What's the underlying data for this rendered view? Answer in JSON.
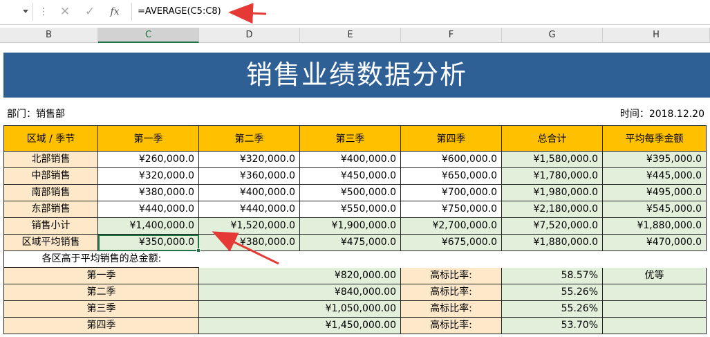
{
  "formula_bar": {
    "formula": "=AVERAGE(C5:C8)",
    "fx_label": "fx"
  },
  "columns": [
    "B",
    "C",
    "D",
    "E",
    "F",
    "G",
    "H"
  ],
  "title": "销售业绩数据分析",
  "department": "部门：销售部",
  "time": "时间：2018.12.20",
  "table": {
    "headers": [
      "区域 / 季节",
      "第一季",
      "第二季",
      "第三季",
      "第四季",
      "总合计",
      "平均每季金额"
    ],
    "rows": [
      [
        "北部销售",
        "¥260,000.0",
        "¥320,000.0",
        "¥400,000.0",
        "¥600,000.0",
        "¥1,580,000.0",
        "¥395,000.0"
      ],
      [
        "中部销售",
        "¥320,000.0",
        "¥360,000.0",
        "¥450,000.0",
        "¥650,000.0",
        "¥1,780,000.0",
        "¥445,000.0"
      ],
      [
        "南部销售",
        "¥380,000.0",
        "¥400,000.0",
        "¥500,000.0",
        "¥700,000.0",
        "¥1,980,000.0",
        "¥495,000.0"
      ],
      [
        "东部销售",
        "¥440,000.0",
        "¥440,000.0",
        "¥550,000.0",
        "¥750,000.0",
        "¥2,180,000.0",
        "¥545,000.0"
      ],
      [
        "销售小计",
        "¥1,400,000.0",
        "¥1,520,000.0",
        "¥1,900,000.0",
        "¥2,700,000.0",
        "¥7,520,000.0",
        "¥1,880,000.0"
      ],
      [
        "区域平均销售",
        "¥350,000.0",
        "¥380,000.0",
        "¥475,000.0",
        "¥675,000.0",
        "¥1,880,000.0",
        "¥470,000.0"
      ]
    ]
  },
  "summary": {
    "label": "各区高于平均销售的总金额:",
    "rows": [
      {
        "season": "第一季",
        "amount": "¥820,000.00",
        "ratio_label": "高标比率:",
        "ratio": "58.57%",
        "grade": "优等"
      },
      {
        "season": "第二季",
        "amount": "¥840,000.00",
        "ratio_label": "高标比率:",
        "ratio": "55.26%",
        "grade": ""
      },
      {
        "season": "第三季",
        "amount": "¥1,050,000.00",
        "ratio_label": "高标比率:",
        "ratio": "55.26%",
        "grade": ""
      },
      {
        "season": "第四季",
        "amount": "¥1,450,000.00",
        "ratio_label": "高标比率:",
        "ratio": "53.70%",
        "grade": ""
      }
    ]
  },
  "colors": {
    "title_band": "#2f6095",
    "header": "#ffc000",
    "beige": "#fde9c9",
    "green": "#e2efda",
    "selection": "#217346",
    "arrow": "#e53935"
  }
}
